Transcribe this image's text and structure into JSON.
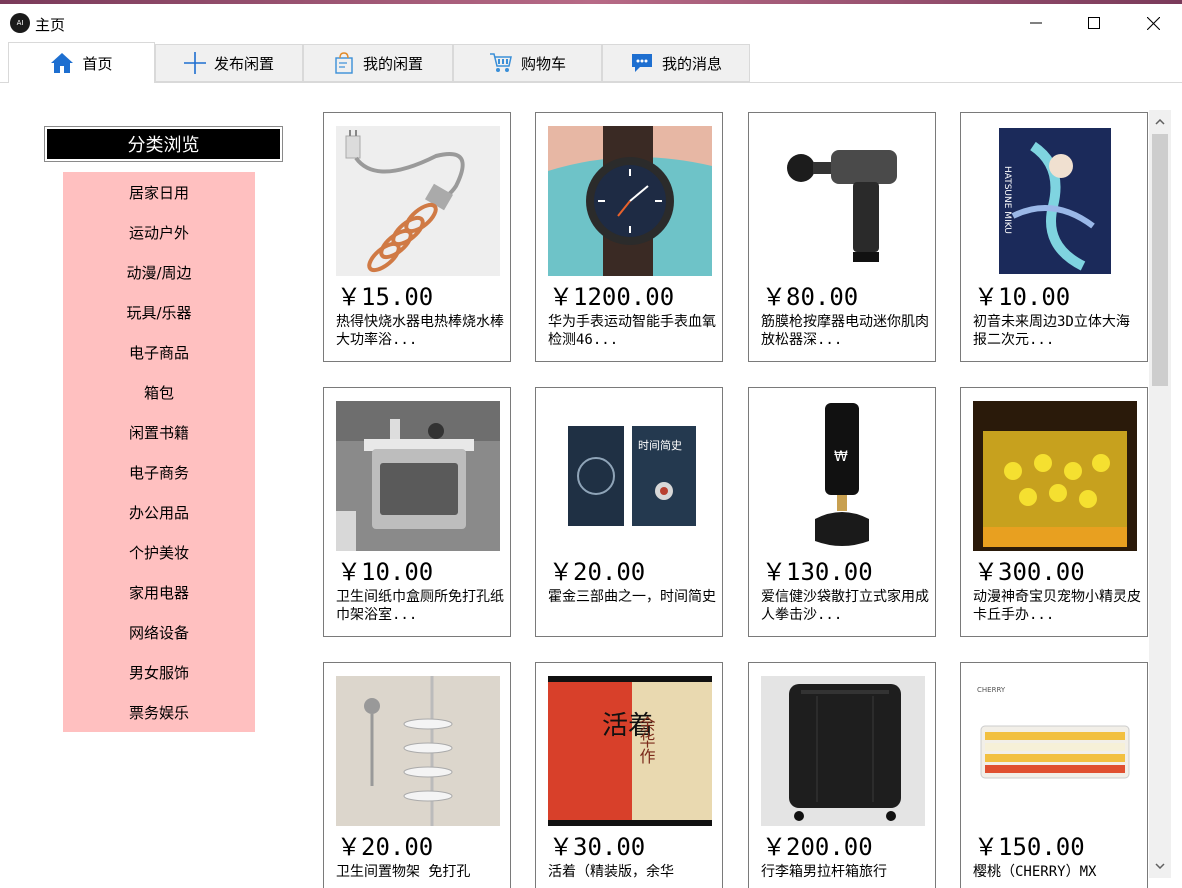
{
  "window": {
    "title": "主页",
    "icon_text": "AI"
  },
  "tabs": [
    {
      "label": "首页",
      "icon": "home-icon"
    },
    {
      "label": "发布闲置",
      "icon": "plus-icon"
    },
    {
      "label": "我的闲置",
      "icon": "bag-icon"
    },
    {
      "label": "购物车",
      "icon": "cart-icon"
    },
    {
      "label": "我的消息",
      "icon": "chat-icon"
    }
  ],
  "categories": {
    "header": "分类浏览",
    "items": [
      "居家日用",
      "运动户外",
      "动漫/周边",
      "玩具/乐器",
      "电子商品",
      "箱包",
      "闲置书籍",
      "电子商务",
      "办公用品",
      "个护美妆",
      "家用电器",
      "网络设备",
      "男女服饰",
      "票务娱乐"
    ]
  },
  "products": [
    {
      "price": "￥15.00",
      "desc": "热得快烧水器电热棒烧水棒大功率浴..."
    },
    {
      "price": "￥1200.00",
      "desc": "华为手表运动智能手表血氧检测46..."
    },
    {
      "price": "￥80.00",
      "desc": "筋膜枪按摩器电动迷你肌肉放松器深..."
    },
    {
      "price": "￥10.00",
      "desc": "初音未来周边3D立体大海报二次元..."
    },
    {
      "price": "￥10.00",
      "desc": "卫生间纸巾盒厕所免打孔纸巾架浴室..."
    },
    {
      "price": "￥20.00",
      "desc": "霍金三部曲之一，时间简史"
    },
    {
      "price": "￥130.00",
      "desc": "爱信健沙袋散打立式家用成人拳击沙..."
    },
    {
      "price": "￥300.00",
      "desc": "动漫神奇宝贝宠物小精灵皮卡丘手办..."
    },
    {
      "price": "￥20.00",
      "desc": "卫生间置物架 免打孔"
    },
    {
      "price": "￥30.00",
      "desc": "活着（精装版，余华"
    },
    {
      "price": "￥200.00",
      "desc": "行李箱男拉杆箱旅行"
    },
    {
      "price": "￥150.00",
      "desc": "樱桃（CHERRY）MX"
    }
  ],
  "product_images": {
    "book1_title": "时间简史",
    "book2_title": "活着",
    "book2_author": "余华作",
    "miku_text": "HATSUNE MIKU",
    "keyboard_brand": "CHERRY"
  },
  "colors": {
    "category_bg": "#ffc0c0",
    "header_bg": "#000000",
    "tab_active_bg": "#ffffff",
    "tab_bg": "#f0f0f0",
    "home_icon": "#1e6fd0"
  }
}
